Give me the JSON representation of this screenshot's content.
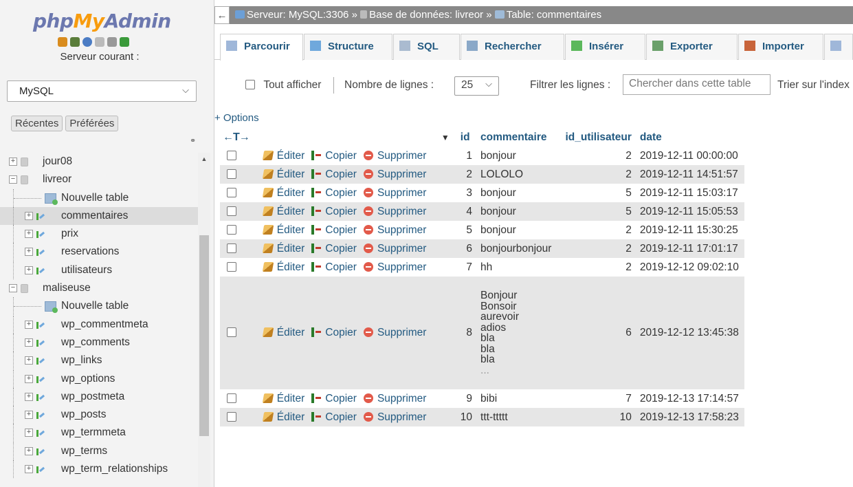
{
  "nav": {
    "logo": {
      "part1": "php",
      "part2": "My",
      "part3": "Admin"
    },
    "quicklinks": [
      {
        "name": "home-icon",
        "color": "#d98c1e"
      },
      {
        "name": "database-icon",
        "color": "#5a7d3a"
      },
      {
        "name": "help-icon",
        "color": "#4b7cc4"
      },
      {
        "name": "doc-icon",
        "color": "#bbbbbb"
      },
      {
        "name": "gear-icon",
        "color": "#999999"
      },
      {
        "name": "reload-icon",
        "color": "#3a9a3a"
      }
    ],
    "server_label": "Serveur courant :",
    "server_value": "MySQL",
    "tabs": [
      "Récentes",
      "Préférées"
    ],
    "tree": [
      {
        "label": "jour08",
        "type": "db",
        "level": 0,
        "expanded": false
      },
      {
        "label": "livreor",
        "type": "db",
        "level": 0,
        "expanded": true
      },
      {
        "label": "Nouvelle table",
        "type": "new",
        "level": 1
      },
      {
        "label": "commentaires",
        "type": "table",
        "level": 1,
        "selected": true
      },
      {
        "label": "prix",
        "type": "table",
        "level": 1
      },
      {
        "label": "reservations",
        "type": "table",
        "level": 1
      },
      {
        "label": "utilisateurs",
        "type": "table",
        "level": 1
      },
      {
        "label": "maliseuse",
        "type": "db",
        "level": 0,
        "expanded": true
      },
      {
        "label": "Nouvelle table",
        "type": "new",
        "level": 1
      },
      {
        "label": "wp_commentmeta",
        "type": "table",
        "level": 1
      },
      {
        "label": "wp_comments",
        "type": "table",
        "level": 1
      },
      {
        "label": "wp_links",
        "type": "table",
        "level": 1
      },
      {
        "label": "wp_options",
        "type": "table",
        "level": 1
      },
      {
        "label": "wp_postmeta",
        "type": "table",
        "level": 1
      },
      {
        "label": "wp_posts",
        "type": "table",
        "level": 1
      },
      {
        "label": "wp_termmeta",
        "type": "table",
        "level": 1
      },
      {
        "label": "wp_terms",
        "type": "table",
        "level": 1
      },
      {
        "label": "wp_term_relationships",
        "type": "table",
        "level": 1
      }
    ]
  },
  "breadcrumb": {
    "back": "←",
    "server": "Serveur: MySQL:3306",
    "database": "Base de données: livreor",
    "table": "Table: commentaires",
    "sep": "»"
  },
  "tabs": [
    {
      "label": "Parcourir",
      "icon": "browse-icon",
      "active": true
    },
    {
      "label": "Structure",
      "icon": "structure-icon"
    },
    {
      "label": "SQL",
      "icon": "sql-icon"
    },
    {
      "label": "Rechercher",
      "icon": "search-icon"
    },
    {
      "label": "Insérer",
      "icon": "insert-icon"
    },
    {
      "label": "Exporter",
      "icon": "export-icon"
    },
    {
      "label": "Importer",
      "icon": "import-icon"
    }
  ],
  "filter": {
    "show_all": "Tout afficher",
    "rows_label": "Nombre de lignes :",
    "rows_value": "25",
    "filter_label": "Filtrer les lignes :",
    "search_placeholder": "Chercher dans cette table",
    "sort_label": "Trier sur l'index"
  },
  "options_label": "+ Options",
  "sort_arrows": "←T→",
  "columns": [
    "id",
    "commentaire",
    "id_utilisateur",
    "date"
  ],
  "actions": {
    "edit": "Éditer",
    "copy": "Copier",
    "delete": "Supprimer"
  },
  "rows": [
    {
      "id": "1",
      "commentaire": [
        "bonjour"
      ],
      "id_utilisateur": "2",
      "date": "2019-12-11 00:00:00"
    },
    {
      "id": "2",
      "commentaire": [
        "LOLOLO"
      ],
      "id_utilisateur": "2",
      "date": "2019-12-11 14:51:57"
    },
    {
      "id": "3",
      "commentaire": [
        "bonjour"
      ],
      "id_utilisateur": "5",
      "date": "2019-12-11 15:03:17"
    },
    {
      "id": "4",
      "commentaire": [
        "bonjour"
      ],
      "id_utilisateur": "5",
      "date": "2019-12-11 15:05:53"
    },
    {
      "id": "5",
      "commentaire": [
        "bonjour"
      ],
      "id_utilisateur": "2",
      "date": "2019-12-11 15:30:25"
    },
    {
      "id": "6",
      "commentaire": [
        "bonjourbonjour"
      ],
      "id_utilisateur": "2",
      "date": "2019-12-11 17:01:17"
    },
    {
      "id": "7",
      "commentaire": [
        "hh"
      ],
      "id_utilisateur": "2",
      "date": "2019-12-12 09:02:10"
    },
    {
      "id": "8",
      "commentaire": [
        "Bonjour",
        "Bonsoir",
        "aurevoir",
        "adios",
        "bla",
        "bla",
        "bla",
        "..."
      ],
      "id_utilisateur": "6",
      "date": "2019-12-12 13:45:38"
    },
    {
      "id": "9",
      "commentaire": [
        "bibi"
      ],
      "id_utilisateur": "7",
      "date": "2019-12-13 17:14:57"
    },
    {
      "id": "10",
      "commentaire": [
        "ttt-ttttt"
      ],
      "id_utilisateur": "10",
      "date": "2019-12-13 17:58:23"
    }
  ],
  "colors": {
    "link": "#235a81",
    "topbar": "#888888",
    "stripe": "#e6e6e6",
    "nav_bg": "#f3f3f3"
  }
}
